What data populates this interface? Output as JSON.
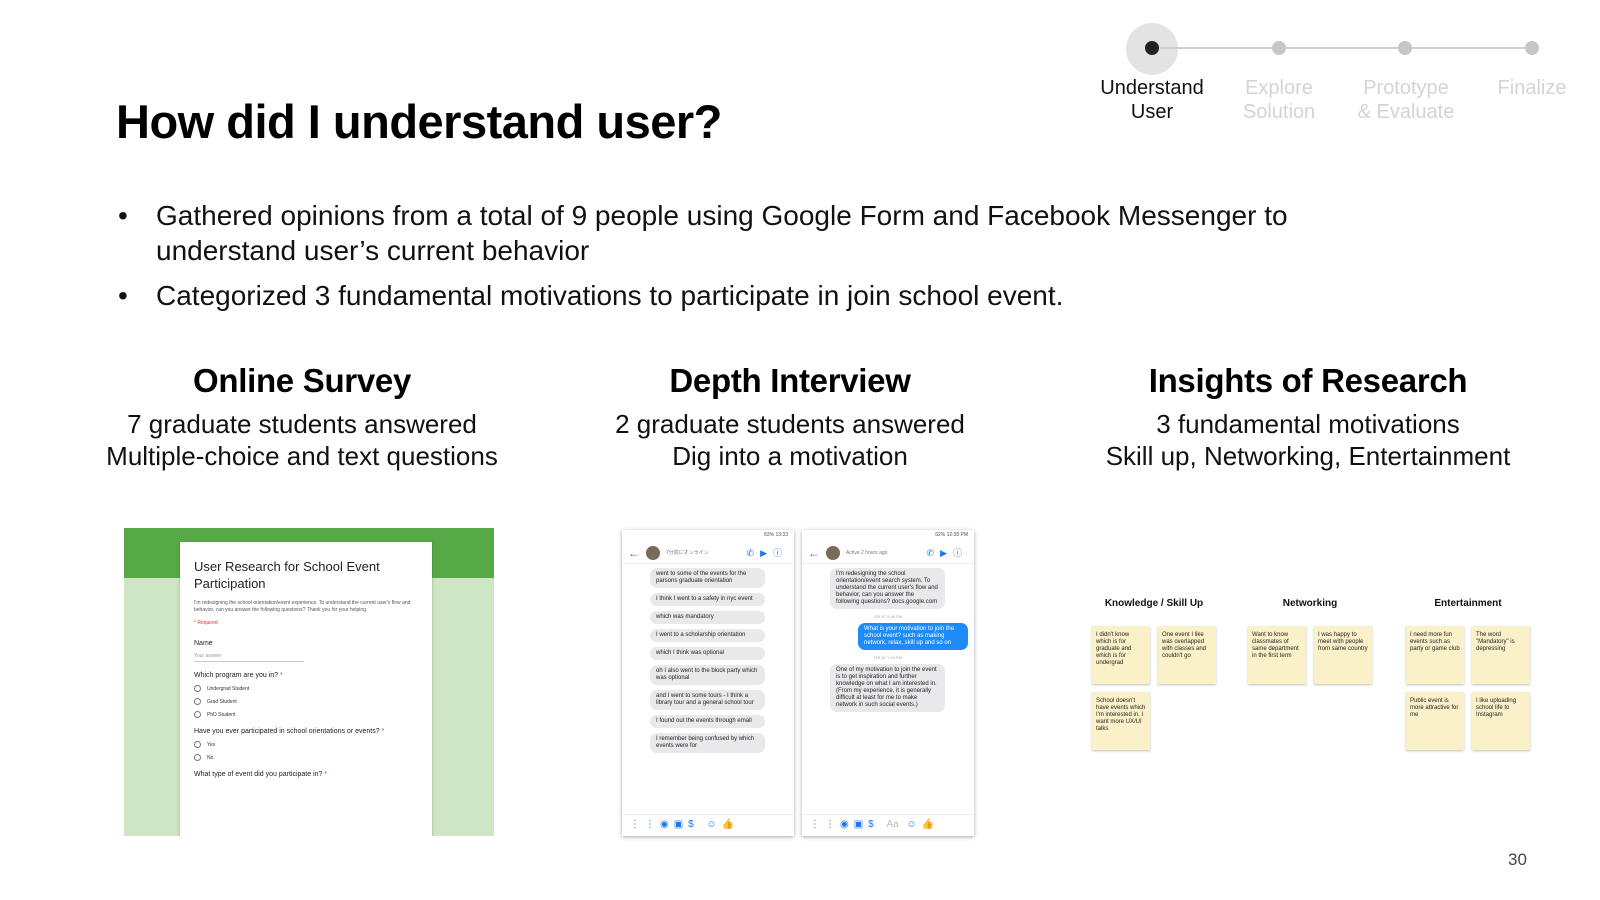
{
  "title": "How did I understand user?",
  "stepper": {
    "steps": [
      {
        "label": "Understand\nUser",
        "line1": "Understand",
        "line2": "User",
        "active": true
      },
      {
        "line1": "Explore",
        "line2": "Solution",
        "active": false
      },
      {
        "line1": "Prototype",
        "line2": "& Evaluate",
        "active": false
      },
      {
        "line1": "Finalize",
        "line2": "",
        "active": false
      }
    ]
  },
  "bullets": [
    "Gathered opinions from a total of 9 people using Google Form and Facebook Messenger to understand user’s current behavior",
    "Categorized 3 fundamental motivations to participate in join school event."
  ],
  "columns": [
    {
      "heading": "Online Survey",
      "line1": "7 graduate students answered",
      "line2": "Multiple-choice and text questions"
    },
    {
      "heading": "Depth Interview",
      "line1": "2 graduate students answered",
      "line2": "Dig into a motivation"
    },
    {
      "heading": "Insights of Research",
      "line1": "3 fundamental motivations",
      "line2": "Skill up, Networking, Entertainment"
    }
  ],
  "survey": {
    "title": "User Research for School Event Participation",
    "description": "I'm redesigning the school orientation/event experience. To understand the current user's flow and behavior, can you answer the following questions? Thank you for your helping.",
    "required": "* Required",
    "q_name": "Name",
    "answer_placeholder": "Your answer",
    "q_program": "Which program are you in?",
    "program_options": [
      "Undergrad Student",
      "Grad Student",
      "PhD Student"
    ],
    "q_participated": "Have you ever participated in school orientations or events?",
    "yesno": [
      "Yes",
      "No"
    ],
    "q_type": "What type of event did you participate in?",
    "star": "*"
  },
  "chat1": {
    "status": "83% 13:33",
    "presence": "7分前にオンライン",
    "messages": [
      {
        "dir": "in",
        "text": "went to some of the events for the parsons graduate orientation"
      },
      {
        "dir": "in",
        "text": "I think I went to a safety in nyc event"
      },
      {
        "dir": "in",
        "text": "which was mandatory"
      },
      {
        "dir": "in",
        "text": "I went to a scholarship orientation"
      },
      {
        "dir": "in",
        "text": "which I think was optional"
      },
      {
        "dir": "in",
        "text": "oh I also went to the block party which was optional"
      },
      {
        "dir": "in",
        "text": "and I went to some tours - I think a library tour and a general school tour"
      },
      {
        "dir": "in",
        "text": "I found out the events through email"
      },
      {
        "dir": "in",
        "text": "I remember being confused by which events were for"
      }
    ]
  },
  "chat2": {
    "status": "62% 12:38 PM",
    "presence": "Active 2 hours ago",
    "messages": [
      {
        "dir": "in",
        "text": "I'm redesigning the school orientation/event search system. To understand the current user's flow and behavior, can you answer the following questions? docs.google.com"
      },
      {
        "dir": "time",
        "text": "FRI AT 5:48 PM"
      },
      {
        "dir": "out",
        "text": "What is your motivation to join the school event? such as making network, relax, skill up and so on"
      },
      {
        "dir": "time",
        "text": "FRI AT 7:04 PM"
      },
      {
        "dir": "in",
        "text": "One of my motivation to join the event is to get inspiration and further knowledge on what I am interested in. (From my experience, it is generally difficult at least for me to make network in such social events.)"
      }
    ],
    "compose_placeholder": "Aa"
  },
  "insights": {
    "groups": [
      {
        "title": "Knowledge / Skill Up",
        "notes": [
          "I didn't know which is for graduate and which is for undergrad",
          "One event I like was overlapped with classes and couldn't go",
          "School doesn't have events which I'm interested in. I want more UX/UI talks"
        ]
      },
      {
        "title": "Networking",
        "notes": [
          "Want to know classmates of same department in the first term",
          "I was happy to meet with people from same country"
        ]
      },
      {
        "title": "Entertainment",
        "notes": [
          "I need more fun events such as party or game club",
          "The word \"Mandatory\" is depressing",
          "Public event is more attractive for me",
          "I like uploading school life to Instagram"
        ]
      }
    ]
  },
  "page_number": "30"
}
